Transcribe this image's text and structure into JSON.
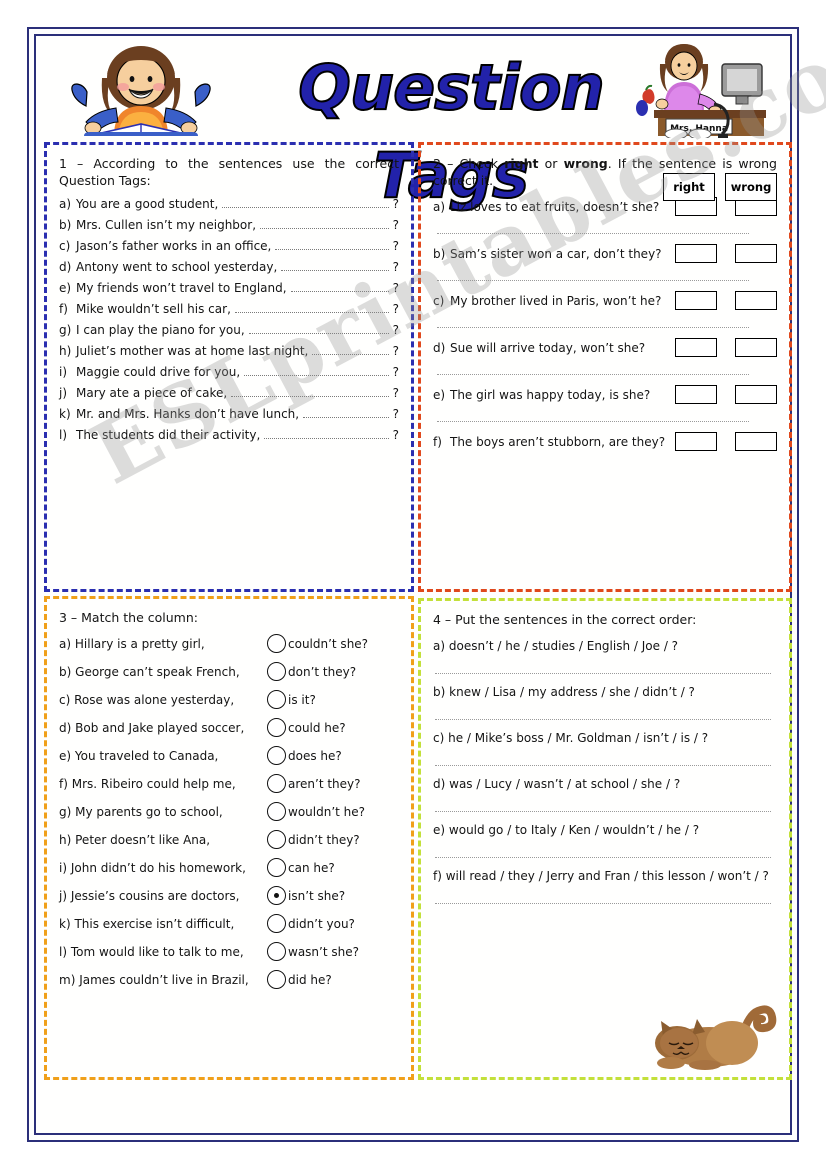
{
  "header": {
    "title": "Question Tags",
    "teacher_nameplate": "Mrs. Hanna",
    "girl_icon": "girl-reading-book-icon",
    "teacher_icon": "teacher-at-computer-icon",
    "cat_icon": "sleeping-cat-icon"
  },
  "watermark": "ESLprintables.com",
  "colors": {
    "page_border": "#2b2f7a",
    "section1_border": "#2b2fb0",
    "section2_border": "#e0491d",
    "section3_border": "#f0a01a",
    "section4_border": "#c3e03a",
    "title": "#2222aa"
  },
  "section1": {
    "prompt": "1 – According to the sentences use the correct Question Tags:",
    "items": [
      {
        "label": "a)",
        "text": "You are a good student,",
        "end": "?"
      },
      {
        "label": "b)",
        "text": "Mrs. Cullen isn’t my neighbor,",
        "end": "?"
      },
      {
        "label": "c)",
        "text": "Jason’s father works in an office,",
        "end": "?"
      },
      {
        "label": "d)",
        "text": "Antony went to school yesterday,",
        "end": "?"
      },
      {
        "label": "e)",
        "text": "My friends won’t travel to England,",
        "end": "?"
      },
      {
        "label": "f)",
        "text": "Mike wouldn’t sell his car,",
        "end": "?"
      },
      {
        "label": "g)",
        "text": "I can play the piano for you,",
        "end": "?"
      },
      {
        "label": "h)",
        "text": "Juliet’s mother was at home last night,",
        "end": "?"
      },
      {
        "label": "i)",
        "text": "Maggie could drive for you,",
        "end": "?"
      },
      {
        "label": "j)",
        "text": "Mary ate a piece of cake,",
        "end": "?"
      },
      {
        "label": "k)",
        "text": "Mr. and Mrs. Hanks don’t have lunch,",
        "end": "?"
      },
      {
        "label": "l)",
        "text": "The students did their activity,",
        "end": "?"
      }
    ]
  },
  "section2": {
    "prompt_pre": "2 – Check ",
    "prompt_bold1": "right",
    "prompt_mid": " or ",
    "prompt_bold2": "wrong",
    "prompt_post": ". If the sentence is wrong correct it.",
    "header_right": "right",
    "header_wrong": "wrong",
    "items": [
      {
        "label": "a)",
        "text": "Liz loves to eat fruits, doesn’t she?"
      },
      {
        "label": "b)",
        "text": "Sam’s sister won a car, don’t they?"
      },
      {
        "label": "c)",
        "text": "My brother lived in Paris, won’t he?"
      },
      {
        "label": "d)",
        "text": "Sue will arrive today, won’t she?"
      },
      {
        "label": "e)",
        "text": "The girl was happy today, is she?"
      },
      {
        "label": "f)",
        "text": "The boys aren’t stubborn, are they?"
      }
    ]
  },
  "section3": {
    "prompt": "3 – Match the column:",
    "items": [
      {
        "label": "a)",
        "left": "Hillary is a pretty girl,",
        "right": "couldn’t she?",
        "marked": false
      },
      {
        "label": "b)",
        "left": "George can’t speak French,",
        "right": "don’t they?",
        "marked": false
      },
      {
        "label": "c)",
        "left": "Rose was alone yesterday,",
        "right": "is it?",
        "marked": false
      },
      {
        "label": "d)",
        "left": "Bob and Jake played soccer,",
        "right": "could he?",
        "marked": false
      },
      {
        "label": "e)",
        "left": "You traveled to Canada,",
        "right": "does he?",
        "marked": false
      },
      {
        "label": "f)",
        "left": "Mrs. Ribeiro could help me,",
        "right": "aren’t they?",
        "marked": false
      },
      {
        "label": "g)",
        "left": "My parents go to school,",
        "right": "wouldn’t he?",
        "marked": false
      },
      {
        "label": "h)",
        "left": "Peter doesn’t like Ana,",
        "right": "didn’t they?",
        "marked": false
      },
      {
        "label": "i)",
        "left": "John didn’t do his homework,",
        "right": "can he?",
        "marked": false
      },
      {
        "label": "j)",
        "left": "Jessie’s cousins are doctors,",
        "right": "isn’t she?",
        "marked": true
      },
      {
        "label": "k)",
        "left": "This exercise isn’t difficult,",
        "right": "didn’t you?",
        "marked": false
      },
      {
        "label": "l)",
        "left": "Tom would like to talk to me,",
        "right": "wasn’t she?",
        "marked": false
      },
      {
        "label": "m)",
        "left": "James couldn’t live in Brazil,",
        "right": "did he?",
        "marked": false
      }
    ]
  },
  "section4": {
    "prompt": "4 – Put the sentences in the correct order:",
    "items": [
      {
        "label": "a)",
        "text": "doesn’t / he / studies / English / Joe / ?"
      },
      {
        "label": "b)",
        "text": "knew / Lisa / my address / she / didn’t / ?"
      },
      {
        "label": "c)",
        "text": "he / Mike’s boss / Mr. Goldman / isn’t / is / ?"
      },
      {
        "label": "d)",
        "text": "was / Lucy / wasn’t / at school / she / ?"
      },
      {
        "label": "e)",
        "text": "would go / to Italy / Ken / wouldn’t / he / ?"
      },
      {
        "label": "f)",
        "text": "will read / they / Jerry and Fran / this lesson / won’t / ?"
      }
    ]
  }
}
